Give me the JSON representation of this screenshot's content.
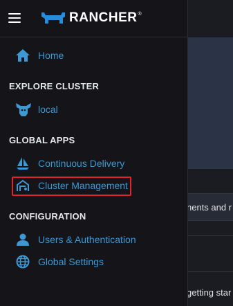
{
  "header": {
    "logo_text": "RANCHER",
    "logo_tm": "®"
  },
  "menu": {
    "home_label": "Home",
    "explore_cluster_title": "EXPLORE CLUSTER",
    "cluster_local_label": "local",
    "global_apps_title": "GLOBAL APPS",
    "continuous_delivery_label": "Continuous Delivery",
    "cluster_management_label": "Cluster Management",
    "configuration_title": "CONFIGURATION",
    "users_auth_label": "Users & Authentication",
    "global_settings_label": "Global Settings"
  },
  "background": {
    "notice_text": "nents and r",
    "footer_text": "getting star"
  },
  "colors": {
    "accent": "#3d98d3",
    "highlight": "#e1262b",
    "menu_bg": "#141419"
  }
}
